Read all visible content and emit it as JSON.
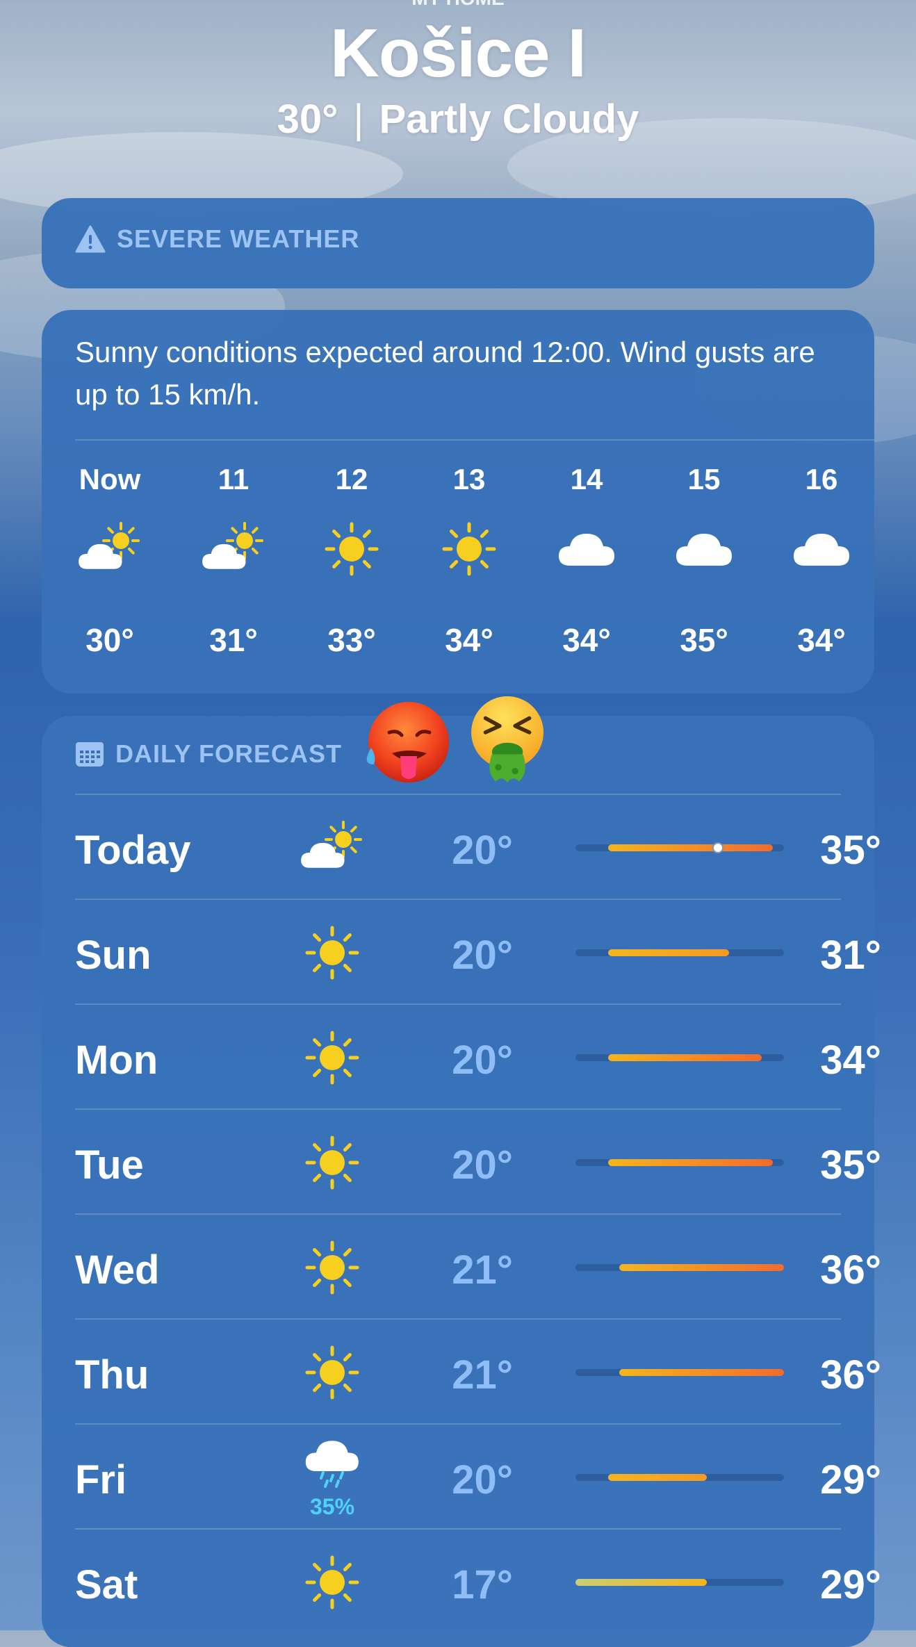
{
  "location": {
    "home_label": "MY HOME",
    "city": "Košice I",
    "current_temp": "30°",
    "separator": "|",
    "condition": "Partly Cloudy"
  },
  "severe": {
    "title": "SEVERE WEATHER",
    "icon": "warning-triangle-icon"
  },
  "hourly": {
    "summary": "Sunny conditions expected around 12:00. Wind gusts are up to 15 km/h.",
    "hours": [
      {
        "label": "Now",
        "icon": "partly-cloudy-icon",
        "temp": "30°"
      },
      {
        "label": "11",
        "icon": "partly-cloudy-icon",
        "temp": "31°"
      },
      {
        "label": "12",
        "icon": "sun-icon",
        "temp": "33°"
      },
      {
        "label": "13",
        "icon": "sun-icon",
        "temp": "34°"
      },
      {
        "label": "14",
        "icon": "cloud-icon",
        "temp": "34°"
      },
      {
        "label": "15",
        "icon": "cloud-icon",
        "temp": "35°"
      },
      {
        "label": "16",
        "icon": "cloud-icon",
        "temp": "34°"
      }
    ]
  },
  "daily": {
    "title": "DAILY FORECAST",
    "icon": "calendar-icon",
    "emojis": [
      "hot-face-emoji",
      "vomiting-face-emoji"
    ],
    "range_min": 17,
    "range_max": 36,
    "current_temp_value": 30,
    "days": [
      {
        "name": "Today",
        "icon": "partly-cloudy-icon",
        "low": "20°",
        "high": "35°",
        "low_val": 20,
        "high_val": 35,
        "precip": ""
      },
      {
        "name": "Sun",
        "icon": "sun-icon",
        "low": "20°",
        "high": "31°",
        "low_val": 20,
        "high_val": 31,
        "precip": ""
      },
      {
        "name": "Mon",
        "icon": "sun-icon",
        "low": "20°",
        "high": "34°",
        "low_val": 20,
        "high_val": 34,
        "precip": ""
      },
      {
        "name": "Tue",
        "icon": "sun-icon",
        "low": "20°",
        "high": "35°",
        "low_val": 20,
        "high_val": 35,
        "precip": ""
      },
      {
        "name": "Wed",
        "icon": "sun-icon",
        "low": "21°",
        "high": "36°",
        "low_val": 21,
        "high_val": 36,
        "precip": ""
      },
      {
        "name": "Thu",
        "icon": "sun-icon",
        "low": "21°",
        "high": "36°",
        "low_val": 21,
        "high_val": 36,
        "precip": ""
      },
      {
        "name": "Fri",
        "icon": "rain-cloud-icon",
        "low": "20°",
        "high": "29°",
        "low_val": 20,
        "high_val": 29,
        "precip": "35%"
      },
      {
        "name": "Sat",
        "icon": "sun-icon",
        "low": "17°",
        "high": "29°",
        "low_val": 17,
        "high_val": 29,
        "precip": ""
      }
    ]
  },
  "colors": {
    "card": "#3871b8",
    "low_temp": "#8fbdf5",
    "header_text": "#9cc3f2",
    "sun": "#f7d01f",
    "bar_warm": "#f5b51e",
    "bar_hot": "#f36b2c",
    "bar_mild": "#c9cf74",
    "precip": "#4fd2f7"
  }
}
